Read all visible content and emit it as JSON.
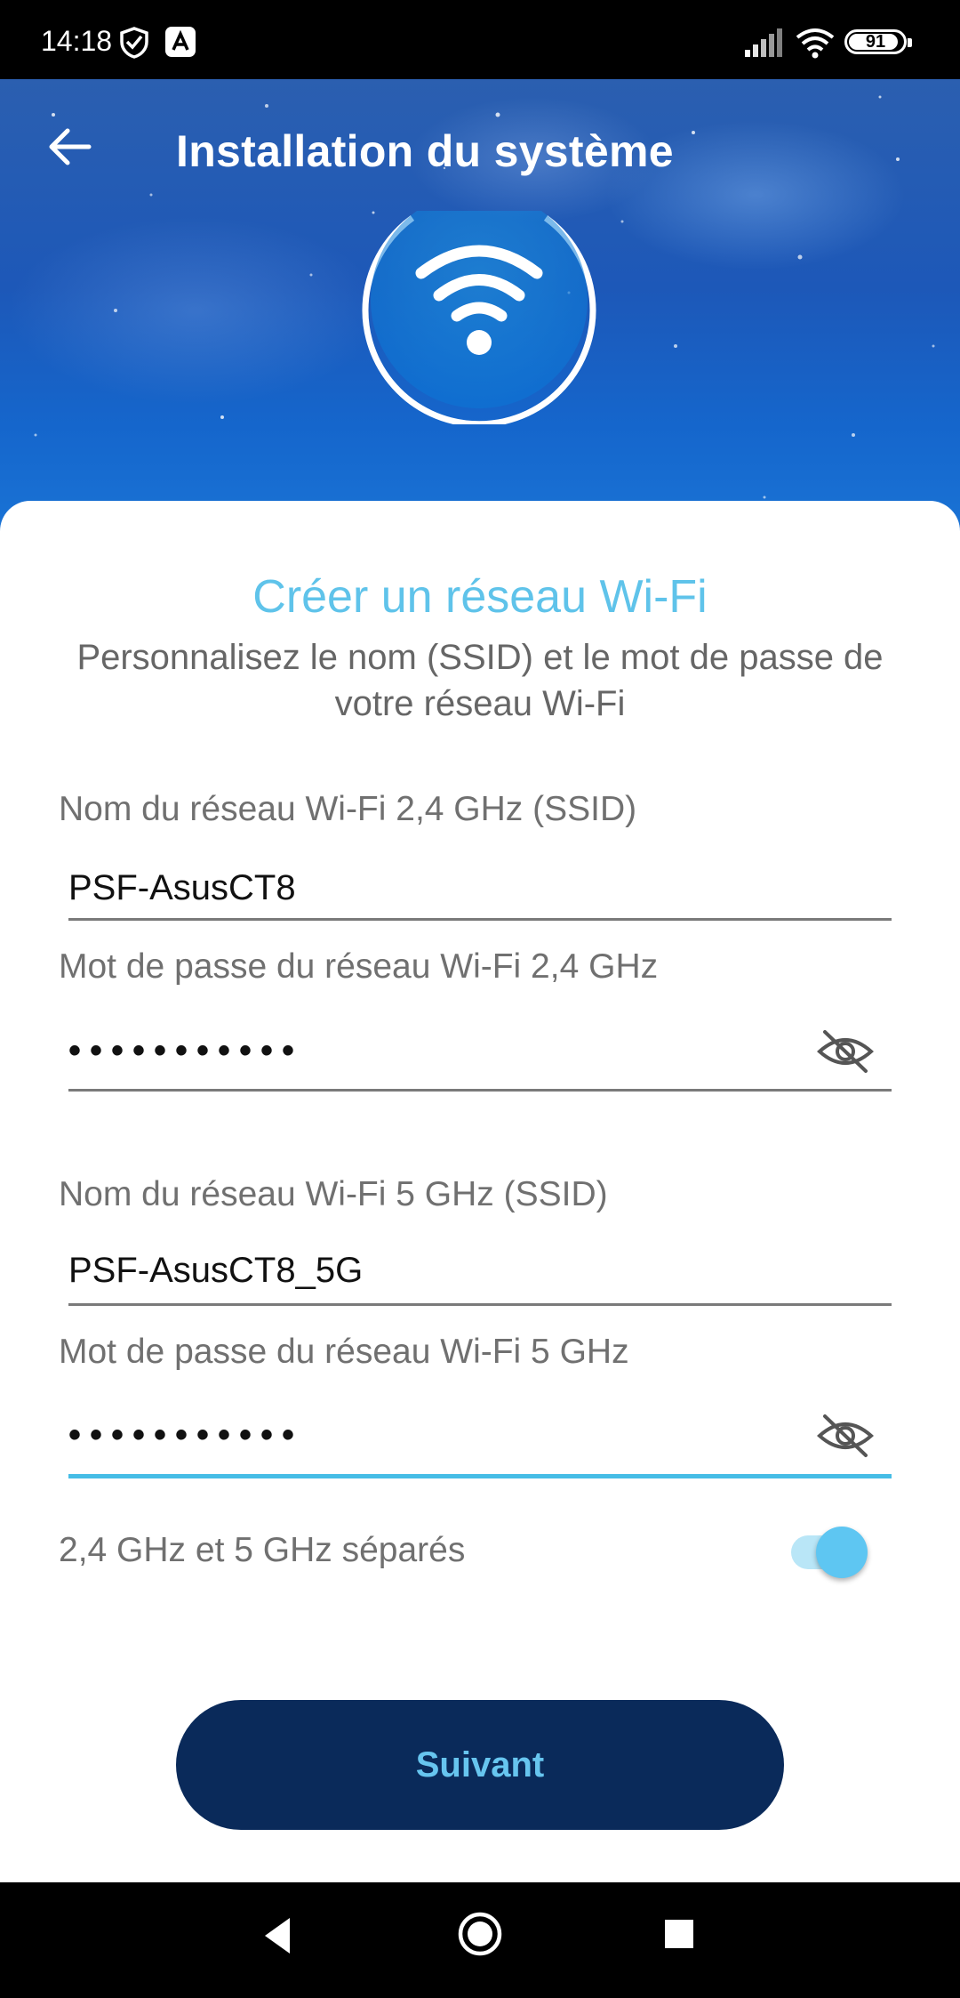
{
  "status_bar": {
    "time": "14:18",
    "battery": "91",
    "battery_level": 0.91,
    "icons": [
      "shield-icon",
      "app-notification-icon",
      "signal-icon",
      "wifi-icon",
      "battery-icon"
    ]
  },
  "header": {
    "title": "Installation du système",
    "back_icon": "back-arrow-icon",
    "logo_icon": "wifi-circle-icon",
    "colors": {
      "top": "#2b5fb0",
      "bottom": "#1a74d6"
    }
  },
  "form": {
    "title": "Créer un réseau Wi-Fi",
    "subtitle": "Personnalisez le nom (SSID) et le mot de passe de votre réseau Wi-Fi",
    "ssid_24_label": "Nom du réseau Wi-Fi 2,4 GHz (SSID)",
    "ssid_24_value": "PSF-AsusCT8",
    "pwd_24_label": "Mot de passe du réseau Wi-Fi 2,4 GHz",
    "pwd_24_value": "•••••••••••",
    "ssid_5_label": "Nom du réseau Wi-Fi 5 GHz (SSID)",
    "ssid_5_value": "PSF-AsusCT8_5G",
    "pwd_5_label": "Mot de passe du réseau Wi-Fi 5 GHz",
    "pwd_5_value": "•••••••••••",
    "toggle_label": "2,4 GHz et 5 GHz séparés",
    "toggle_on": true,
    "next_button": "Suivant",
    "colors": {
      "accent": "#5fc3ea",
      "button": "#0a2a5a",
      "button_text": "#67c5ef"
    }
  },
  "nav_bar": {
    "buttons": [
      "back-triangle-icon",
      "home-circle-icon",
      "recents-square-icon"
    ]
  }
}
